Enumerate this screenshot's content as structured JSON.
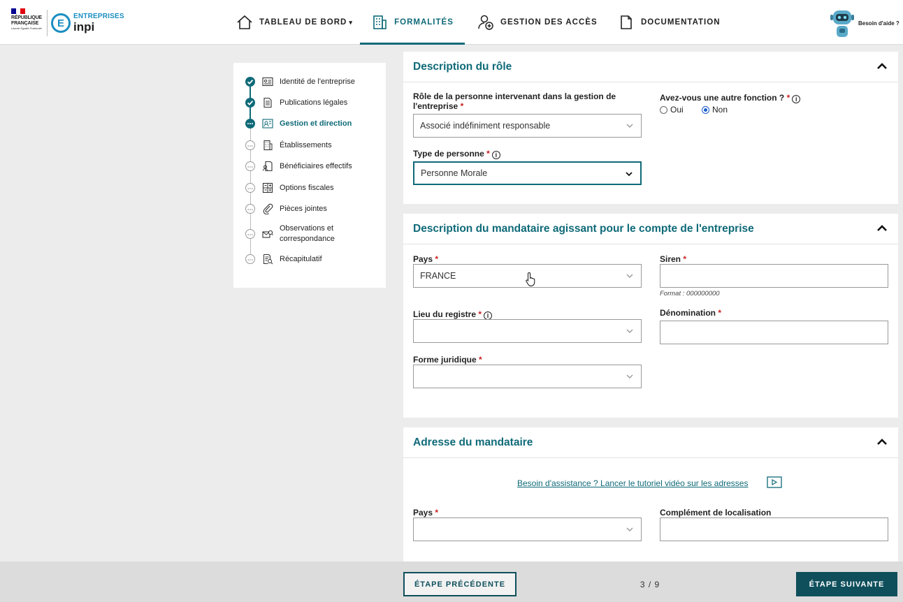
{
  "header": {
    "logo_rf": {
      "line1": "RÉPUBLIQUE",
      "line2": "FRANÇAISE",
      "motto": "Liberté Égalité Fraternité"
    },
    "logo_inpi": {
      "letter": "E",
      "top": "ENTREPRISES",
      "bottom": "inpi"
    },
    "nav": [
      {
        "label": "TABLEAU DE BORD",
        "caret": "▾"
      },
      {
        "label": "FORMALITÉS"
      },
      {
        "label": "GESTION DES ACCÈS"
      },
      {
        "label": "DOCUMENTATION"
      }
    ],
    "help_label": "Besoin d'aide ?"
  },
  "stepper": {
    "steps": [
      {
        "label": "Identité de l'entreprise",
        "state": "done"
      },
      {
        "label": "Publications légales",
        "state": "done"
      },
      {
        "label": "Gestion et direction",
        "state": "current"
      },
      {
        "label": "Établissements",
        "state": "todo"
      },
      {
        "label": "Bénéficiaires effectifs",
        "state": "todo"
      },
      {
        "label": "Options fiscales",
        "state": "todo"
      },
      {
        "label": "Pièces jointes",
        "state": "todo"
      },
      {
        "label": "Observations et correspondance",
        "state": "todo"
      },
      {
        "label": "Récapitulatif",
        "state": "todo"
      }
    ]
  },
  "role_section": {
    "title": "Description du rôle",
    "role_label": "Rôle de la personne intervenant dans la gestion de l'entreprise",
    "role_value": "Associé indéfiniment responsable",
    "other_function_label": "Avez-vous une autre fonction ?",
    "radio_yes": "Oui",
    "radio_no": "Non",
    "radio_selected": "Non",
    "type_label": "Type de personne",
    "type_value": "Personne Morale"
  },
  "mandataire_section": {
    "title": "Description du mandataire agissant pour le compte de l'entreprise",
    "pays_label": "Pays",
    "pays_value": "FRANCE",
    "siren_label": "Siren",
    "siren_value": "",
    "siren_hint": "Format : 000000000",
    "lieu_label": "Lieu du registre",
    "lieu_value": "",
    "denomination_label": "Dénomination",
    "denomination_value": "",
    "forme_label": "Forme juridique",
    "forme_value": ""
  },
  "adresse_section": {
    "title": "Adresse du mandataire",
    "tutorial_link": "Besoin d'assistance ? Lancer le tutoriel vidéo sur les adresses",
    "pays_label": "Pays",
    "pays_value": "",
    "complement_label": "Complément de localisation",
    "complement_value": ""
  },
  "footer": {
    "prev_label": "ÉTAPE PRÉCÉDENTE",
    "pager": "3 / 9",
    "next_label": "ÉTAPE SUIVANTE"
  },
  "colors": {
    "accent": "#0f6a78",
    "dark_accent": "#0f4f5c",
    "required": "#c81e1e",
    "inpi_blue": "#1a8ec2"
  },
  "icons": [
    "home-icon",
    "building-icon",
    "user-add-icon",
    "document-icon",
    "robot-icon",
    "chevron-up-icon",
    "chevron-down-icon",
    "check-icon",
    "video-icon",
    "info-icon"
  ],
  "step_icons": [
    "id-card-icon",
    "newspaper-icon",
    "management-icon",
    "establishment-icon",
    "beneficiaries-icon",
    "tax-options-icon",
    "attachment-icon",
    "observations-icon",
    "summary-icon"
  ]
}
